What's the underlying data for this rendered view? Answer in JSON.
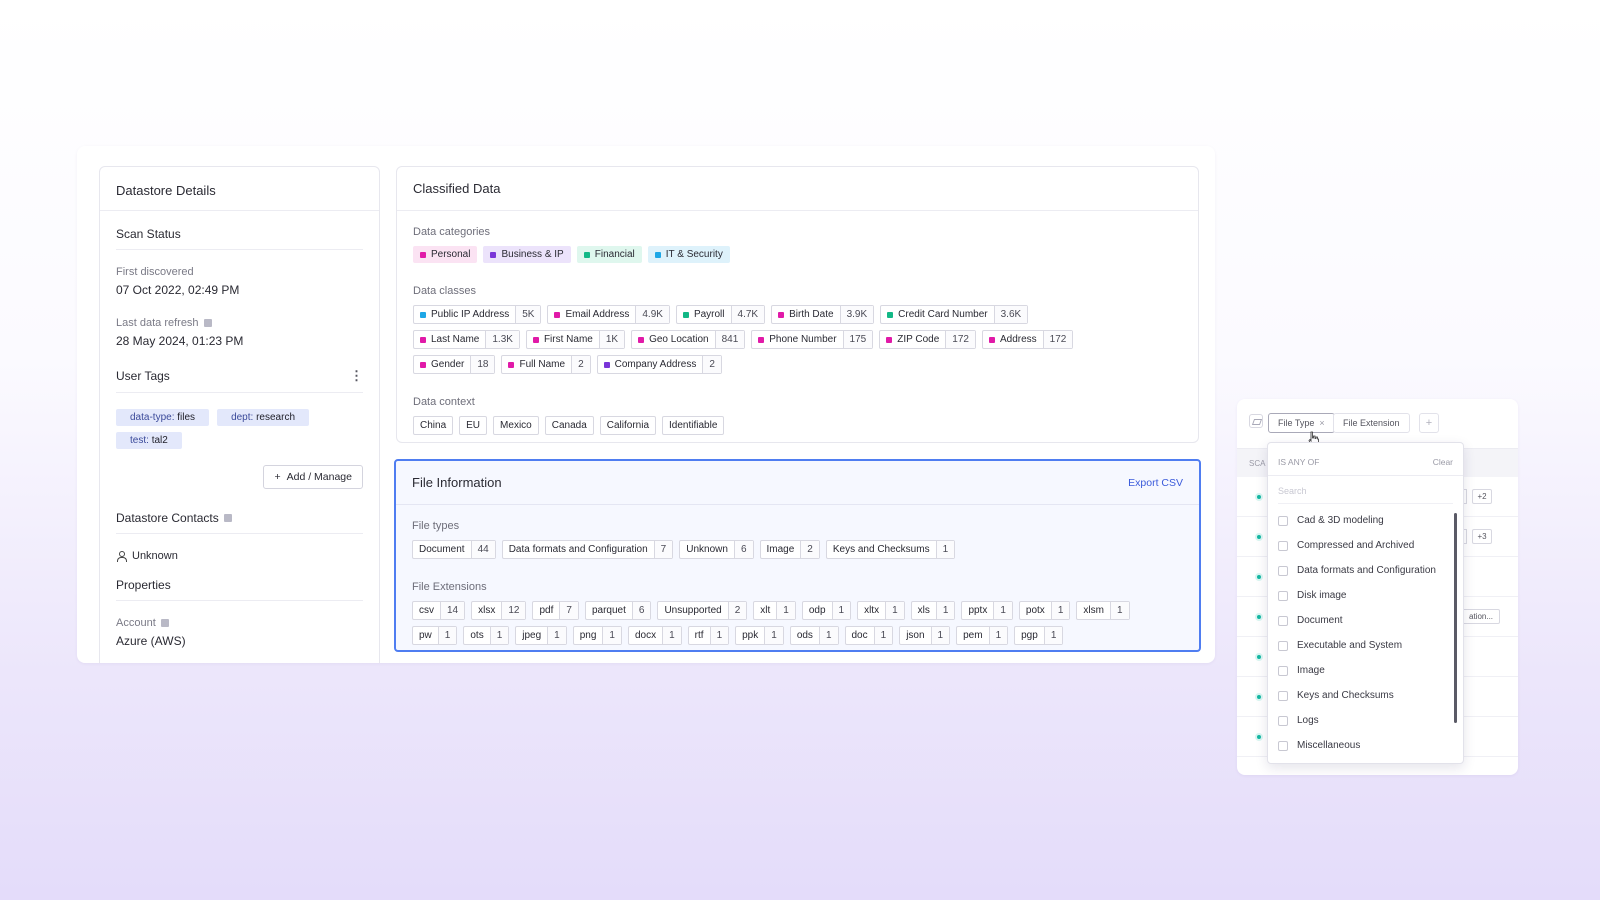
{
  "datastore": {
    "title": "Datastore Details",
    "scan_status": "Scan Status",
    "first_discovered_label": "First discovered",
    "first_discovered_value": "07 Oct 2022, 02:49 PM",
    "last_refresh_label": "Last data refresh",
    "last_refresh_value": "28 May 2024, 01:23 PM",
    "user_tags_title": "User Tags",
    "user_tags": [
      {
        "key": "data-type:",
        "value": "files"
      },
      {
        "key": "dept:",
        "value": "research"
      },
      {
        "key": "test:",
        "value": "tal2"
      }
    ],
    "add_manage_label": "Add / Manage",
    "contacts_title": "Datastore Contacts",
    "contact_value": "Unknown",
    "properties_title": "Properties",
    "account_label": "Account",
    "account_value": "Azure (AWS)"
  },
  "classified": {
    "title": "Classified Data",
    "categories_label": "Data categories",
    "categories": [
      {
        "name": "Personal",
        "color": "#e11aa8",
        "bg": "#fbe3f3"
      },
      {
        "name": "Business & IP",
        "color": "#7a35d8",
        "bg": "#ece3fb"
      },
      {
        "name": "Financial",
        "color": "#12b886",
        "bg": "#dff7ee"
      },
      {
        "name": "IT & Security",
        "color": "#1ea7e6",
        "bg": "#def2fb"
      }
    ],
    "classes_label": "Data classes",
    "classes": [
      {
        "name": "Public IP Address",
        "count": "5K",
        "color": "#1ea7e6"
      },
      {
        "name": "Email Address",
        "count": "4.9K",
        "color": "#e11aa8"
      },
      {
        "name": "Payroll",
        "count": "4.7K",
        "color": "#12b886"
      },
      {
        "name": "Birth Date",
        "count": "3.9K",
        "color": "#e11aa8"
      },
      {
        "name": "Credit Card Number",
        "count": "3.6K",
        "color": "#12b886"
      },
      {
        "name": "Last Name",
        "count": "1.3K",
        "color": "#e11aa8"
      },
      {
        "name": "First Name",
        "count": "1K",
        "color": "#e11aa8"
      },
      {
        "name": "Geo Location",
        "count": "841",
        "color": "#e11aa8"
      },
      {
        "name": "Phone Number",
        "count": "175",
        "color": "#e11aa8"
      },
      {
        "name": "ZIP Code",
        "count": "172",
        "color": "#e11aa8"
      },
      {
        "name": "Address",
        "count": "172",
        "color": "#e11aa8"
      },
      {
        "name": "Gender",
        "count": "18",
        "color": "#e11aa8"
      },
      {
        "name": "Full Name",
        "count": "2",
        "color": "#e11aa8"
      },
      {
        "name": "Company Address",
        "count": "2",
        "color": "#7a35d8"
      }
    ],
    "context_label": "Data context",
    "context": [
      "China",
      "EU",
      "Mexico",
      "Canada",
      "California",
      "Identifiable"
    ]
  },
  "file_info": {
    "title": "File Information",
    "export_label": "Export CSV",
    "types_label": "File types",
    "types": [
      {
        "name": "Document",
        "count": "44"
      },
      {
        "name": "Data formats and Configuration",
        "count": "7"
      },
      {
        "name": "Unknown",
        "count": "6"
      },
      {
        "name": "Image",
        "count": "2"
      },
      {
        "name": "Keys and Checksums",
        "count": "1"
      }
    ],
    "extensions_label": "File Extensions",
    "extensions": [
      {
        "name": "csv",
        "count": "14"
      },
      {
        "name": "xlsx",
        "count": "12"
      },
      {
        "name": "pdf",
        "count": "7"
      },
      {
        "name": "parquet",
        "count": "6"
      },
      {
        "name": "Unsupported",
        "count": "2"
      },
      {
        "name": "xlt",
        "count": "1"
      },
      {
        "name": "odp",
        "count": "1"
      },
      {
        "name": "xltx",
        "count": "1"
      },
      {
        "name": "xls",
        "count": "1"
      },
      {
        "name": "pptx",
        "count": "1"
      },
      {
        "name": "potx",
        "count": "1"
      },
      {
        "name": "xlsm",
        "count": "1"
      },
      {
        "name": "pw",
        "count": "1"
      },
      {
        "name": "ots",
        "count": "1"
      },
      {
        "name": "jpeg",
        "count": "1"
      },
      {
        "name": "png",
        "count": "1"
      },
      {
        "name": "docx",
        "count": "1"
      },
      {
        "name": "rtf",
        "count": "1"
      },
      {
        "name": "ppk",
        "count": "1"
      },
      {
        "name": "ods",
        "count": "1"
      },
      {
        "name": "doc",
        "count": "1"
      },
      {
        "name": "json",
        "count": "1"
      },
      {
        "name": "pem",
        "count": "1"
      },
      {
        "name": "pgp",
        "count": "1"
      }
    ]
  },
  "filter": {
    "chip_file_type": "File Type",
    "chip_file_extension": "File Extension",
    "plus": "+",
    "table_header": "SCA",
    "badges": [
      "+2",
      "+3"
    ],
    "trunc_label": "ation...",
    "popover": {
      "header": "IS ANY OF",
      "clear": "Clear",
      "search_placeholder": "Search",
      "options": [
        "Cad & 3D modeling",
        "Compressed and Archived",
        "Data formats and Configuration",
        "Disk image",
        "Document",
        "Executable and System",
        "Image",
        "Keys and Checksums",
        "Logs",
        "Miscellaneous"
      ]
    }
  }
}
